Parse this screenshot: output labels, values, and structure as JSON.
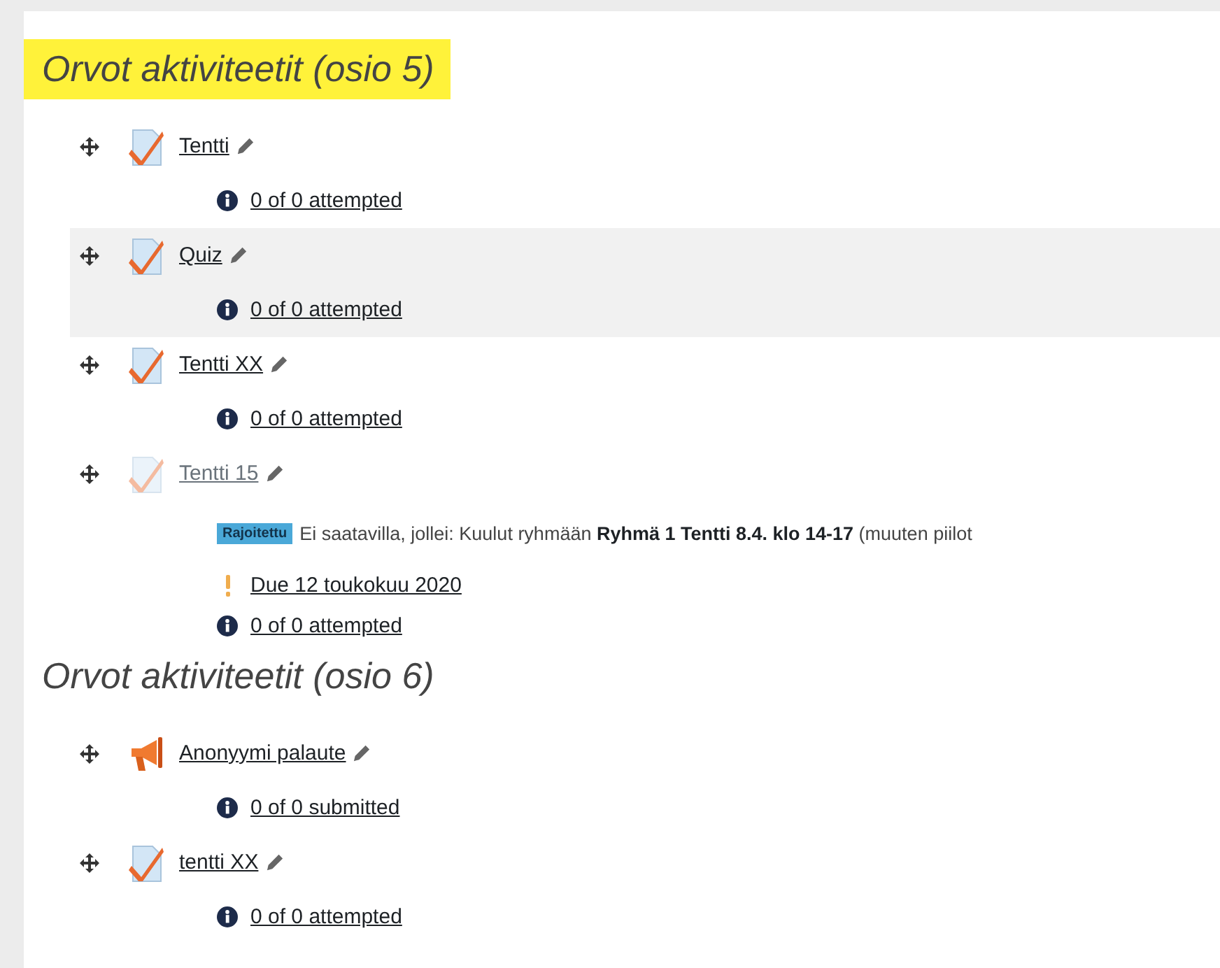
{
  "sections": [
    {
      "title": "Orvot aktiviteetit (osio 5)",
      "highlighted": true,
      "activities": [
        {
          "kind": "quiz",
          "name": "Tentti",
          "dimmed": false,
          "highlighted": false,
          "info": "0 of 0 attempted"
        },
        {
          "kind": "quiz",
          "name": "Quiz",
          "dimmed": false,
          "highlighted": true,
          "info": "0 of 0 attempted"
        },
        {
          "kind": "quiz",
          "name": "Tentti XX",
          "dimmed": false,
          "highlighted": false,
          "info": "0 of 0 attempted"
        },
        {
          "kind": "quiz",
          "name": "Tentti 15",
          "dimmed": true,
          "highlighted": false,
          "restriction": {
            "badge": "Rajoitettu",
            "text": "Ei saatavilla, jollei: Kuulut ryhmään **Ryhmä 1 Tentti 8.4. klo 14-17** (muuten piilot"
          },
          "due": "Due 12 toukokuu 2020",
          "info": "0 of 0 attempted"
        }
      ]
    },
    {
      "title": "Orvot aktiviteetit (osio 6)",
      "highlighted": false,
      "activities": [
        {
          "kind": "feedback",
          "name": "Anonyymi palaute",
          "dimmed": false,
          "highlighted": false,
          "info": "0 of 0 submitted"
        },
        {
          "kind": "quiz",
          "name": "tentti XX",
          "dimmed": false,
          "highlighted": false,
          "info": "0 of 0 attempted"
        }
      ]
    }
  ]
}
